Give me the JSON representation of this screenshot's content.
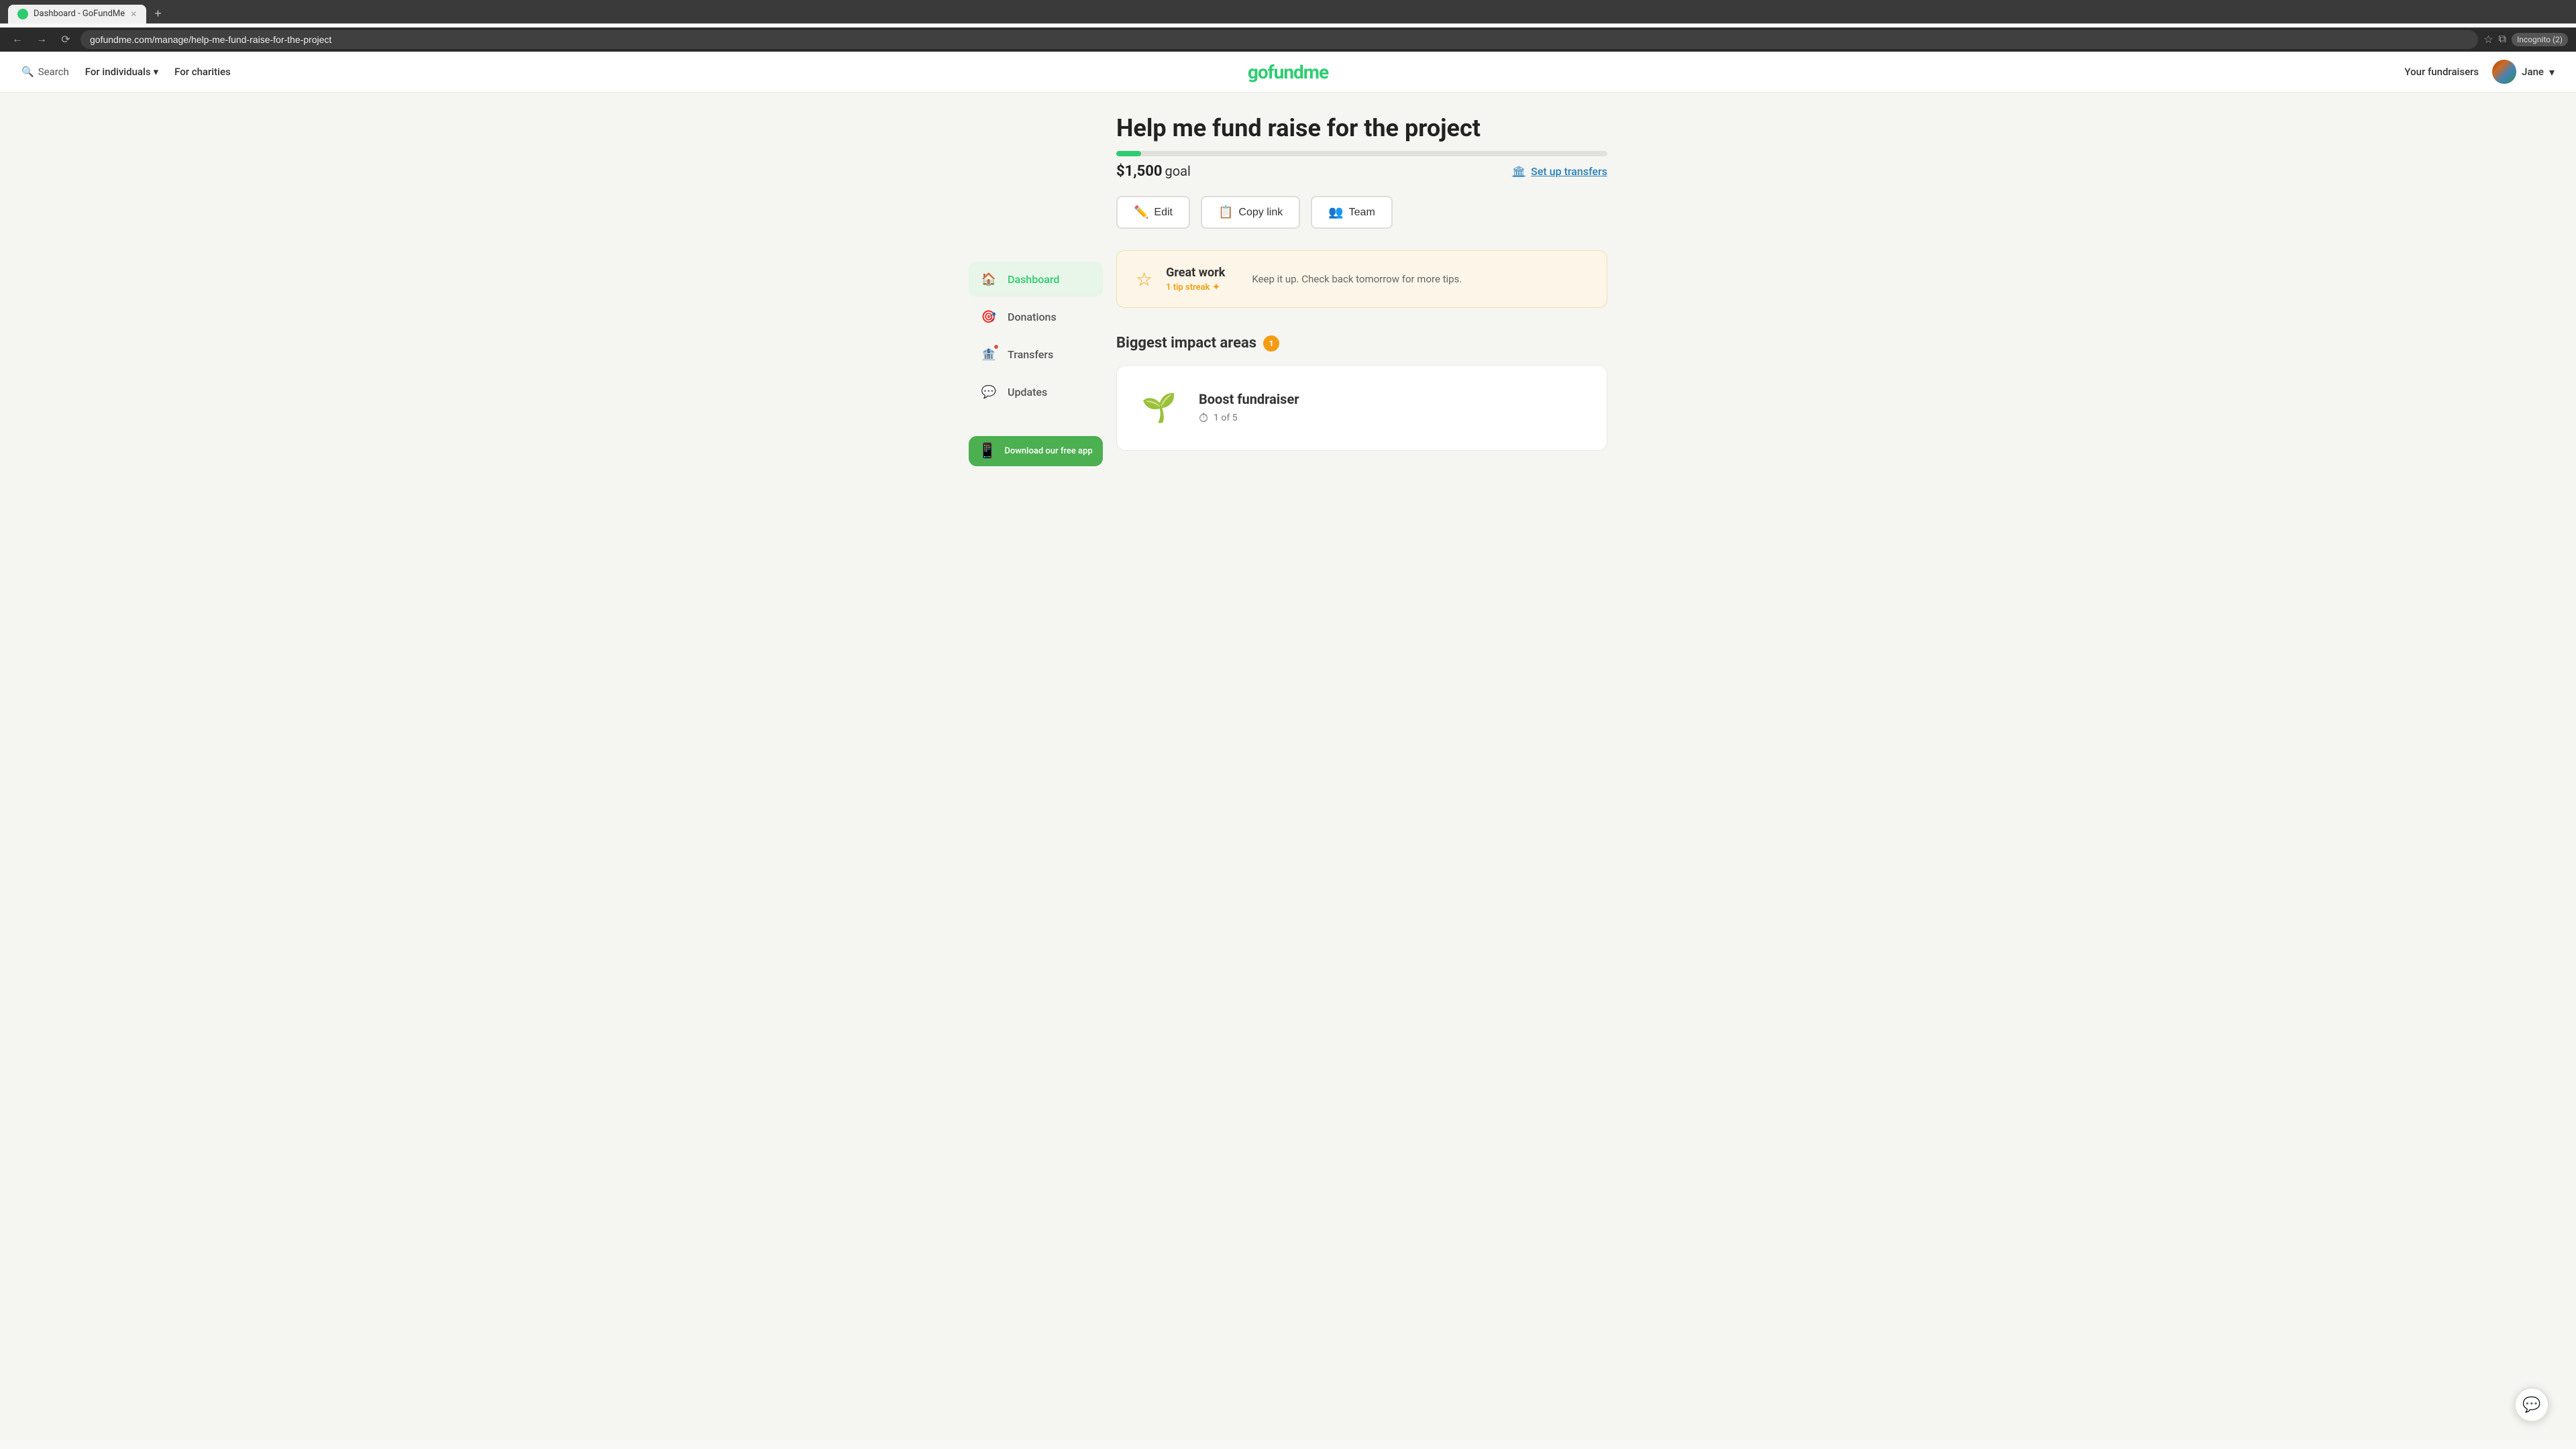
{
  "browser": {
    "tab_title": "Dashboard - GoFundMe",
    "url": "gofundme.com/manage/help-me-fund-raise-for-the-project",
    "incognito_label": "Incognito (2)",
    "new_tab_icon": "+"
  },
  "nav": {
    "search_label": "Search",
    "for_individuals_label": "For individuals",
    "for_charities_label": "For charities",
    "logo_text": "gofundme",
    "your_fundraisers_label": "Your fundraisers",
    "user_name": "Jane"
  },
  "sidebar": {
    "dashboard_label": "Dashboard",
    "donations_label": "Donations",
    "transfers_label": "Transfers",
    "updates_label": "Updates",
    "download_app_label": "Download our free app"
  },
  "campaign": {
    "title": "Help me fund raise for the project",
    "goal_amount": "$1,500",
    "goal_label": "goal",
    "progress_percent": 5,
    "set_up_transfers_label": "Set up transfers",
    "edit_label": "Edit",
    "copy_link_label": "Copy link",
    "team_label": "Team"
  },
  "tip_banner": {
    "title": "Great work",
    "streak_label": "1 tip streak",
    "streak_icon": "✦",
    "message": "Keep it up. Check back tomorrow for more tips."
  },
  "impact": {
    "title": "Biggest impact areas",
    "badge_count": "1",
    "boost_title": "Boost fundraiser",
    "boost_counter": "1 of 5"
  }
}
